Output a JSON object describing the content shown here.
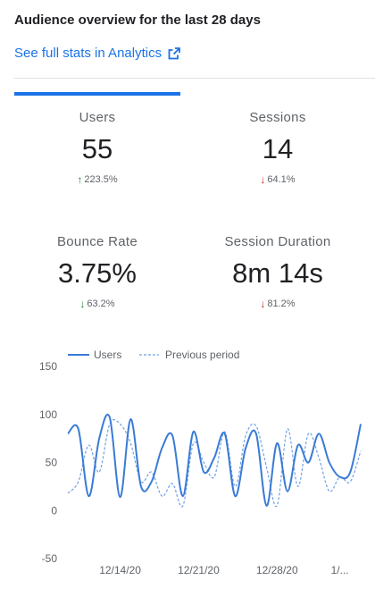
{
  "header": {
    "title": "Audience overview for the last 28 days",
    "analytics_link": "See full stats in Analytics"
  },
  "metrics": {
    "users": {
      "label": "Users",
      "value": "55",
      "change": "223.5%",
      "direction": "up"
    },
    "sessions": {
      "label": "Sessions",
      "value": "14",
      "change": "64.1%",
      "direction": "down"
    },
    "bounce_rate": {
      "label": "Bounce Rate",
      "value": "3.75%",
      "change": "63.2%",
      "direction": "down"
    },
    "session_duration": {
      "label": "Session Duration",
      "value": "8m 14s",
      "change": "81.2%",
      "direction": "down"
    }
  },
  "colors": {
    "accent": "#1a73e8",
    "up": "#188038",
    "down": "#c5221f",
    "series": "#3a7bd5"
  },
  "chart_data": {
    "type": "line",
    "ylim": [
      -50,
      150
    ],
    "yticks": [
      "150",
      "100",
      "50",
      "0",
      "-50"
    ],
    "xticks": [
      "12/14/20",
      "12/21/20",
      "12/28/20",
      "1/..."
    ],
    "series": [
      {
        "name": "Users",
        "style": "solid",
        "x": [
          0,
          2,
          4,
          6,
          8,
          10,
          12,
          14,
          16,
          18,
          20,
          22,
          24,
          26,
          28,
          30,
          32,
          34,
          36,
          38,
          40,
          42,
          44,
          46,
          48,
          50,
          52,
          54,
          56
        ],
        "values": [
          80,
          85,
          15,
          75,
          97,
          14,
          95,
          25,
          30,
          65,
          78,
          15,
          82,
          40,
          55,
          80,
          15,
          65,
          80,
          5,
          70,
          20,
          68,
          50,
          80,
          50,
          35,
          40,
          90
        ]
      },
      {
        "name": "Previous period",
        "style": "dashed",
        "x": [
          0,
          2,
          4,
          6,
          8,
          10,
          12,
          14,
          16,
          18,
          20,
          22,
          24,
          26,
          28,
          30,
          32,
          34,
          36,
          38,
          40,
          42,
          44,
          46,
          48,
          50,
          52,
          54,
          56
        ],
        "values": [
          18,
          30,
          68,
          40,
          90,
          90,
          70,
          30,
          40,
          15,
          28,
          5,
          70,
          50,
          35,
          82,
          25,
          78,
          88,
          45,
          5,
          85,
          25,
          80,
          55,
          20,
          35,
          30,
          62
        ]
      }
    ],
    "legend_position": "top-center",
    "grid": false
  }
}
